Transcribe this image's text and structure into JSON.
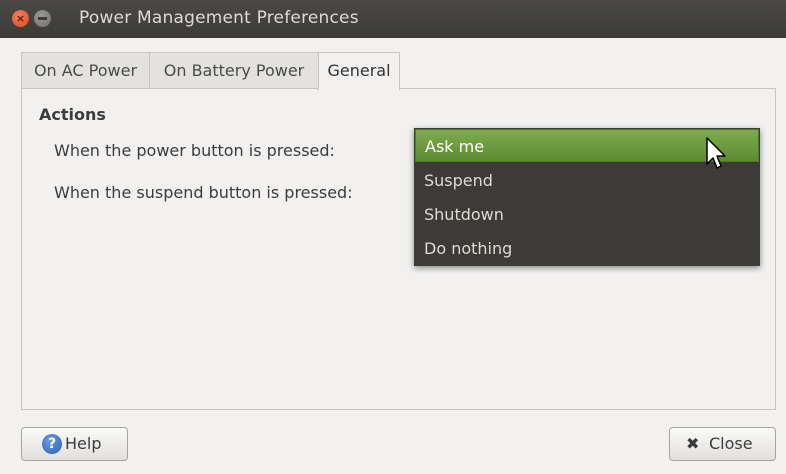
{
  "window": {
    "title": "Power Management Preferences",
    "close_icon": "close-icon",
    "minimize_icon": "minimize-icon"
  },
  "tabs": [
    {
      "label": "On AC Power",
      "active": false
    },
    {
      "label": "On Battery Power",
      "active": false
    },
    {
      "label": "General",
      "active": true
    }
  ],
  "general": {
    "section_title": "Actions",
    "power_button_label": "When the power button is pressed:",
    "suspend_button_label": "When the suspend button is pressed:"
  },
  "dropdown": {
    "options": [
      "Ask me",
      "Suspend",
      "Shutdown",
      "Do nothing"
    ],
    "selected": "Ask me"
  },
  "buttons": {
    "help_label": "Help",
    "close_label": "Close"
  },
  "colors": {
    "selection": "#6f9c41",
    "menu_bg": "#3c3b37",
    "titlebar": "#3c3b37"
  }
}
